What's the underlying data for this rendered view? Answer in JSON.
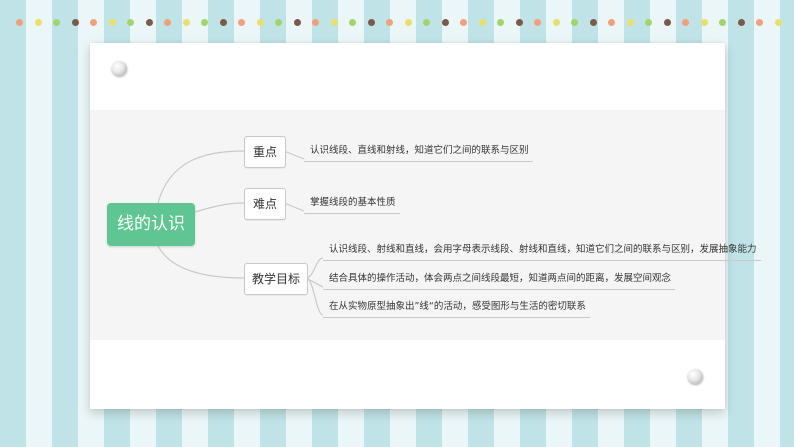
{
  "mindmap": {
    "central": "线的认识",
    "branches": [
      {
        "label": "重点",
        "items": [
          "认识线段、直线和射线，知道它们之间的联系与区别"
        ]
      },
      {
        "label": "难点",
        "items": [
          "掌握线段的基本性质"
        ]
      },
      {
        "label": "教学目标",
        "items": [
          "认识线段、射线和直线，会用字母表示线段、射线和直线，知道它们之间的联系与区别，发展抽象能力",
          "结合具体的操作活动，体会两点之间线段最短，知道两点间的距离，发展空间观念",
          "在从实物原型抽象出”线“的活动，感受图形与生活的密切联系"
        ]
      }
    ]
  },
  "colors": {
    "central_fill": "#5fc592",
    "stripe_dark": "#bfe3e6",
    "stripe_light": "#eaf6f7",
    "dots": [
      "#f0a07a",
      "#e9df6d",
      "#a2d46b",
      "#7a5a4a"
    ]
  }
}
